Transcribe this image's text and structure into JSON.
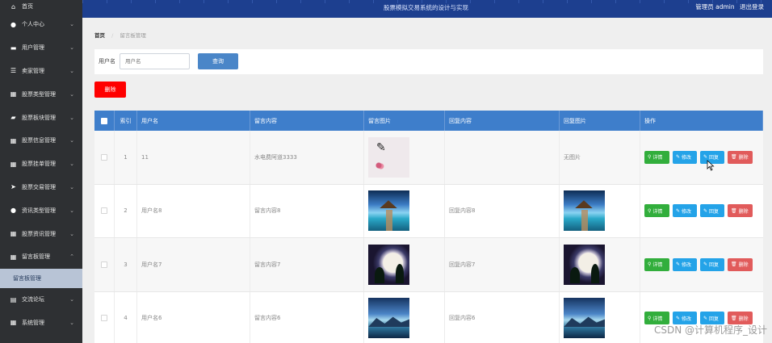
{
  "topbar": {
    "title": "股票模拟交易系统的设计与实现",
    "user_role": "管理员 admin",
    "logout": "退出登录"
  },
  "sidebar": {
    "items": [
      {
        "label": "首页",
        "icon": "home-icon"
      },
      {
        "label": "个人中心",
        "icon": "person-icon"
      },
      {
        "label": "用户管理",
        "icon": "monitor-icon"
      },
      {
        "label": "卖家管理",
        "icon": "sliders-icon"
      },
      {
        "label": "股票类型管理",
        "icon": "grid-icon"
      },
      {
        "label": "股票板块管理",
        "icon": "chat-icon"
      },
      {
        "label": "股票信息管理",
        "icon": "grid-icon"
      },
      {
        "label": "股票挂单管理",
        "icon": "grid-icon"
      },
      {
        "label": "股票交易管理",
        "icon": "send-icon"
      },
      {
        "label": "资讯类型管理",
        "icon": "person-icon"
      },
      {
        "label": "股票资讯管理",
        "icon": "grid-icon"
      },
      {
        "label": "留言板管理",
        "icon": "grid-icon"
      }
    ],
    "sub_item": "留言板管理",
    "items_after": [
      {
        "label": "交流论坛",
        "icon": "clipboard-icon"
      },
      {
        "label": "系统管理",
        "icon": "grid-icon"
      }
    ]
  },
  "breadcrumb": {
    "home": "首页",
    "current": "留言板管理"
  },
  "search": {
    "label": "用户名",
    "placeholder": "用户名",
    "button": "查询"
  },
  "toolbar": {
    "delete": "删除"
  },
  "table": {
    "headers": [
      "索引",
      "用户名",
      "留言内容",
      "留言图片",
      "回复内容",
      "回复图片",
      "操作"
    ],
    "rows": [
      {
        "index": "1",
        "user": "11",
        "message": "水电费阿道3333",
        "reply": "",
        "reply_image_text": "无图片"
      },
      {
        "index": "2",
        "user": "用户名8",
        "message": "留言内容8",
        "reply": "回复内容8",
        "reply_image_text": ""
      },
      {
        "index": "3",
        "user": "用户名7",
        "message": "留言内容7",
        "reply": "回复内容7",
        "reply_image_text": ""
      },
      {
        "index": "4",
        "user": "用户名6",
        "message": "留言内容6",
        "reply": "回复内容6",
        "reply_image_text": ""
      }
    ],
    "ops": {
      "detail": "详情",
      "edit": "修改",
      "reply": "回复",
      "delete": "删除"
    }
  },
  "watermark": "CSDN @计算机程序_设计",
  "colors": {
    "sidebar": "#2e3033",
    "topbar": "#1d3f8f",
    "table_header": "#3e7ecb",
    "delete": "#ff0000",
    "detail": "#32ae3c",
    "edit": "#24a3e8",
    "remove": "#e15b5b"
  }
}
